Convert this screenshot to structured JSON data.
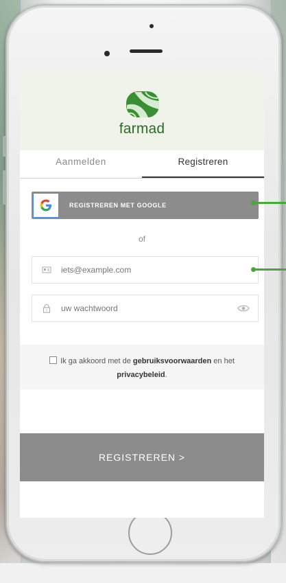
{
  "brand": {
    "name": "farmad",
    "accent": "#2a6b27",
    "logo_icon": "farmad-leaf-logo"
  },
  "tabs": [
    {
      "label": "Aanmelden",
      "active": false
    },
    {
      "label": "Registreren",
      "active": true
    }
  ],
  "google": {
    "label": "REGISTREREN MET GOOGLE",
    "icon": "google-g-icon"
  },
  "separator": {
    "label": "of"
  },
  "email": {
    "placeholder": "iets@example.com",
    "value": "",
    "icon": "id-card-icon"
  },
  "password": {
    "placeholder": "uw wachtwoord",
    "value": "",
    "icon": "lock-icon",
    "toggle_icon": "eye-icon"
  },
  "consent": {
    "checked": false,
    "text_before": "Ik ga akkoord met de",
    "terms_link": "gebruiksvoorwaarden",
    "text_middle": "en het",
    "privacy_link": "privacybeleid",
    "text_after": "."
  },
  "submit": {
    "label": "REGISTREREN >"
  },
  "colors": {
    "button_gray": "#8c8c8c",
    "callout_green": "#4aa63c",
    "header_bg": "#eff3ea"
  }
}
